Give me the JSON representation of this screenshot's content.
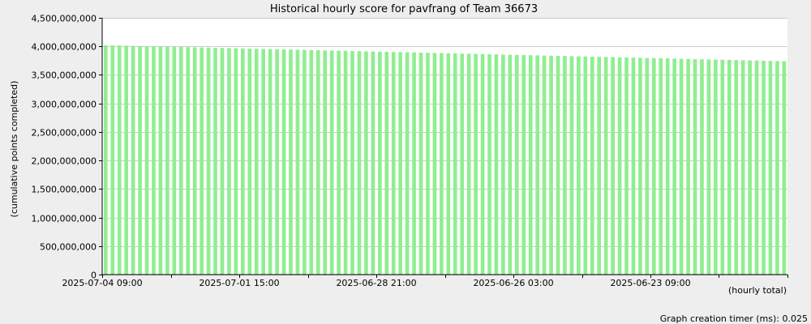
{
  "chart_data": {
    "type": "bar",
    "title": "Historical hourly score for pavfrang of Team 36673",
    "ylabel": "(cumulative points completed)",
    "xlabel": "(hourly total)",
    "ylim": [
      0,
      4500000000
    ],
    "y_ticks": [
      0,
      500000000,
      1000000000,
      1500000000,
      2000000000,
      2500000000,
      3000000000,
      3500000000,
      4000000000,
      4500000000
    ],
    "y_tick_labels": [
      "0",
      "500,000,000",
      "1,000,000,000",
      "1,500,000,000",
      "2,000,000,000",
      "2,500,000,000",
      "3,000,000,000",
      "3,500,000,000",
      "4,000,000,000",
      "4,500,000,000"
    ],
    "x_tick_labels": [
      "2025-07-04 09:00",
      "2025-07-01 15:00",
      "2025-06-28 21:00",
      "2025-06-26 03:00",
      "2025-06-23 09:00"
    ],
    "bar_color": "#90ee90",
    "grid": true,
    "values_first": 4020000000,
    "values_last": 3740000000,
    "bar_count": 100
  },
  "footer": {
    "timer_text": "Graph creation timer (ms): 0.025"
  }
}
